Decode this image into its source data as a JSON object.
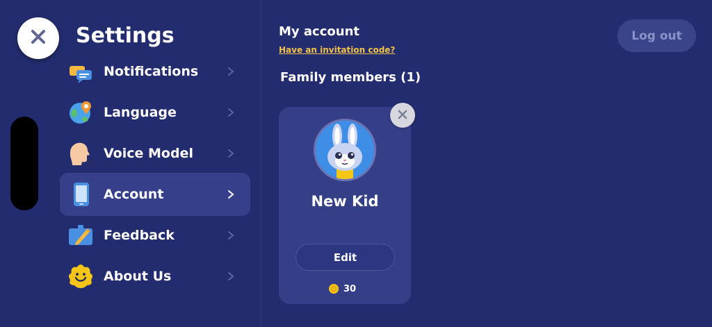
{
  "settings": {
    "title": "Settings",
    "close_icon": "close-icon"
  },
  "menu": {
    "items": [
      {
        "label": "Notifications",
        "icon": "notifications-icon",
        "active": false
      },
      {
        "label": "Language",
        "icon": "globe-icon",
        "active": false
      },
      {
        "label": "Voice Model",
        "icon": "voice-head-icon",
        "active": false
      },
      {
        "label": "Account",
        "icon": "phone-icon",
        "active": true
      },
      {
        "label": "Feedback",
        "icon": "feedback-icon",
        "active": false
      },
      {
        "label": "About Us",
        "icon": "smiley-flower-icon",
        "active": false
      }
    ]
  },
  "account": {
    "title": "My account",
    "invitation_link": "Have an invitation code?",
    "logout_label": "Log out"
  },
  "family": {
    "title": "Family members (1)",
    "members": [
      {
        "name": "New Kid",
        "avatar_icon": "bunny-avatar",
        "edit_label": "Edit",
        "coins": "30"
      }
    ]
  },
  "colors": {
    "background": "#232c6e",
    "active_item": "#36408a",
    "card": "#353f88",
    "link": "#f2c24a",
    "logout_text": "#8a93c9"
  }
}
